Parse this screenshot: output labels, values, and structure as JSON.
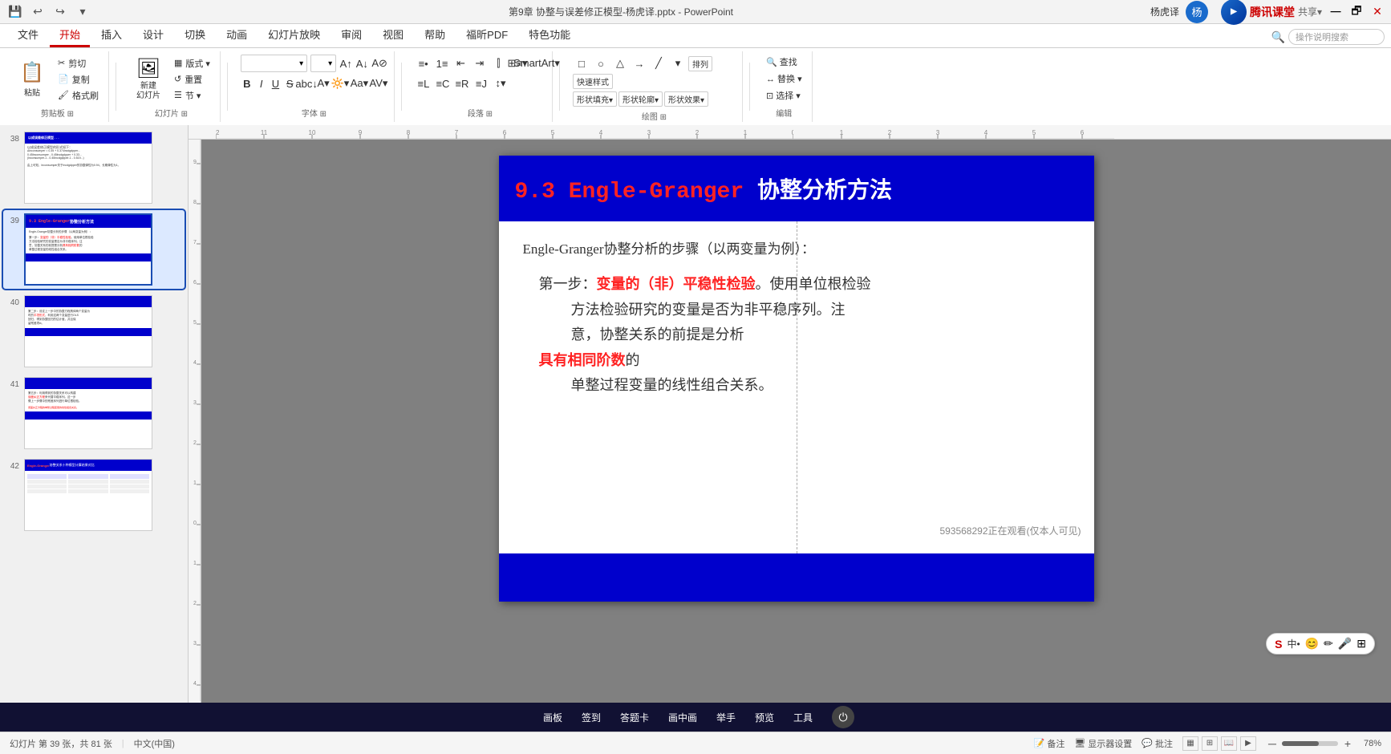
{
  "titlebar": {
    "title": "第9章 协整与误差修正模型-杨虎译.pptx - PowerPoint",
    "user": "杨虎译",
    "quickaccess": [
      "save",
      "undo",
      "redo",
      "customize"
    ]
  },
  "ribbon": {
    "tabs": [
      "文件",
      "开始",
      "插入",
      "设计",
      "切换",
      "动画",
      "幻灯片放映",
      "审阅",
      "视图",
      "帮助",
      "福昕PDF",
      "特色功能",
      "操作说明搜索"
    ],
    "active_tab": "开始",
    "groups": {
      "clipboard": {
        "label": "剪贴板",
        "buttons": [
          "粘贴",
          "剪切",
          "复制",
          "格式刷"
        ]
      },
      "slides": {
        "label": "幻灯片",
        "buttons": [
          "新建幻灯片",
          "版式",
          "重置",
          "节"
        ]
      },
      "font": {
        "label": "字体",
        "name": "",
        "size": ""
      },
      "paragraph": {
        "label": "段落"
      },
      "drawing": {
        "label": "绘图"
      },
      "editing": {
        "label": "编辑",
        "buttons": [
          "查找",
          "替换",
          "选择"
        ]
      }
    }
  },
  "format_bar": {
    "font_name": "",
    "font_size": "",
    "bold": "B",
    "italic": "I",
    "underline": "U",
    "strikethrough": "S",
    "increase_font": "A↑",
    "decrease_font": "A↓",
    "clear_format": "A"
  },
  "slides": [
    {
      "number": "38",
      "header": "",
      "body_preview": "以成误差修正模型的形式如下：\nΔlnconsumper=0.45·Δlncdgdpper+0.33\n(lnconsumper-1−0.45·lncdgdpper-1−0.519lncdgdpper)\n由上可知，lnconsumper关于lncdgdpper的协整弹性为0.94，长期弹性为1。"
    },
    {
      "number": "39",
      "header": "9.3 Engle-Granger 协整分析方法",
      "body_preview": "Engle-Granger协整分析的步骤（以两变量为例）：\n第一步：变量的（非）平稳性检验。使用单位根检验方法检验研究的变量是否为非平稳序列。注意，协整关系的前提是分析具有相同阶数的单整过程变量的线性组合关系。",
      "active": true
    },
    {
      "number": "40",
      "header": "",
      "body_preview": "第二步：设定上一步中的协整方程具体两个变量为时的平坦形式，利用这两个变量进行OLS回归，得到协整回归的估计值，并且保留残差项εt。"
    },
    {
      "number": "41",
      "header": "",
      "body_preview": "第五步：利用得到的协整关系可以构建误差纠正方程来代替平稳序列。这一步骤上一步骤中的残差序列进行单位根检验。\n误差纠正方程的单整过程变量的线性组合关系。"
    },
    {
      "number": "42",
      "header": "Engle-Granger 协整关系十种模型计算结果对比",
      "body_preview": "表格数据..."
    }
  ],
  "canvas": {
    "slide_title": "9.3 Engle-Granger 协整分析方法",
    "intro_text": "Engle-Granger协整分析的步骤（以两变量为例）：",
    "step1_label": "第一步：",
    "step1_highlight": "变量的（非）平稳性检验",
    "step1_text1": "。使用单位根检验",
    "step1_text2": "方法检验研究的变量是否为非平稳序列。注",
    "step1_text3": "意，协整关系的前提是分析",
    "step1_highlight2": "具有相同阶数",
    "step1_text4": "的",
    "step1_text5": "单整过程变量的线性组合关系。",
    "viewer_note": "593568292正在观看(仅本人可见)"
  },
  "bottom_toolbar": {
    "buttons": [
      "画板",
      "签到",
      "答题卡",
      "画中画",
      "举手",
      "预览",
      "工具"
    ]
  },
  "status_bar": {
    "slide_count": "幻灯片 第 39 张，共 81 张",
    "language": "中文(中国)",
    "notes": "备注",
    "display_settings": "显示器设置",
    "comments": "批注",
    "zoom": "78%"
  }
}
